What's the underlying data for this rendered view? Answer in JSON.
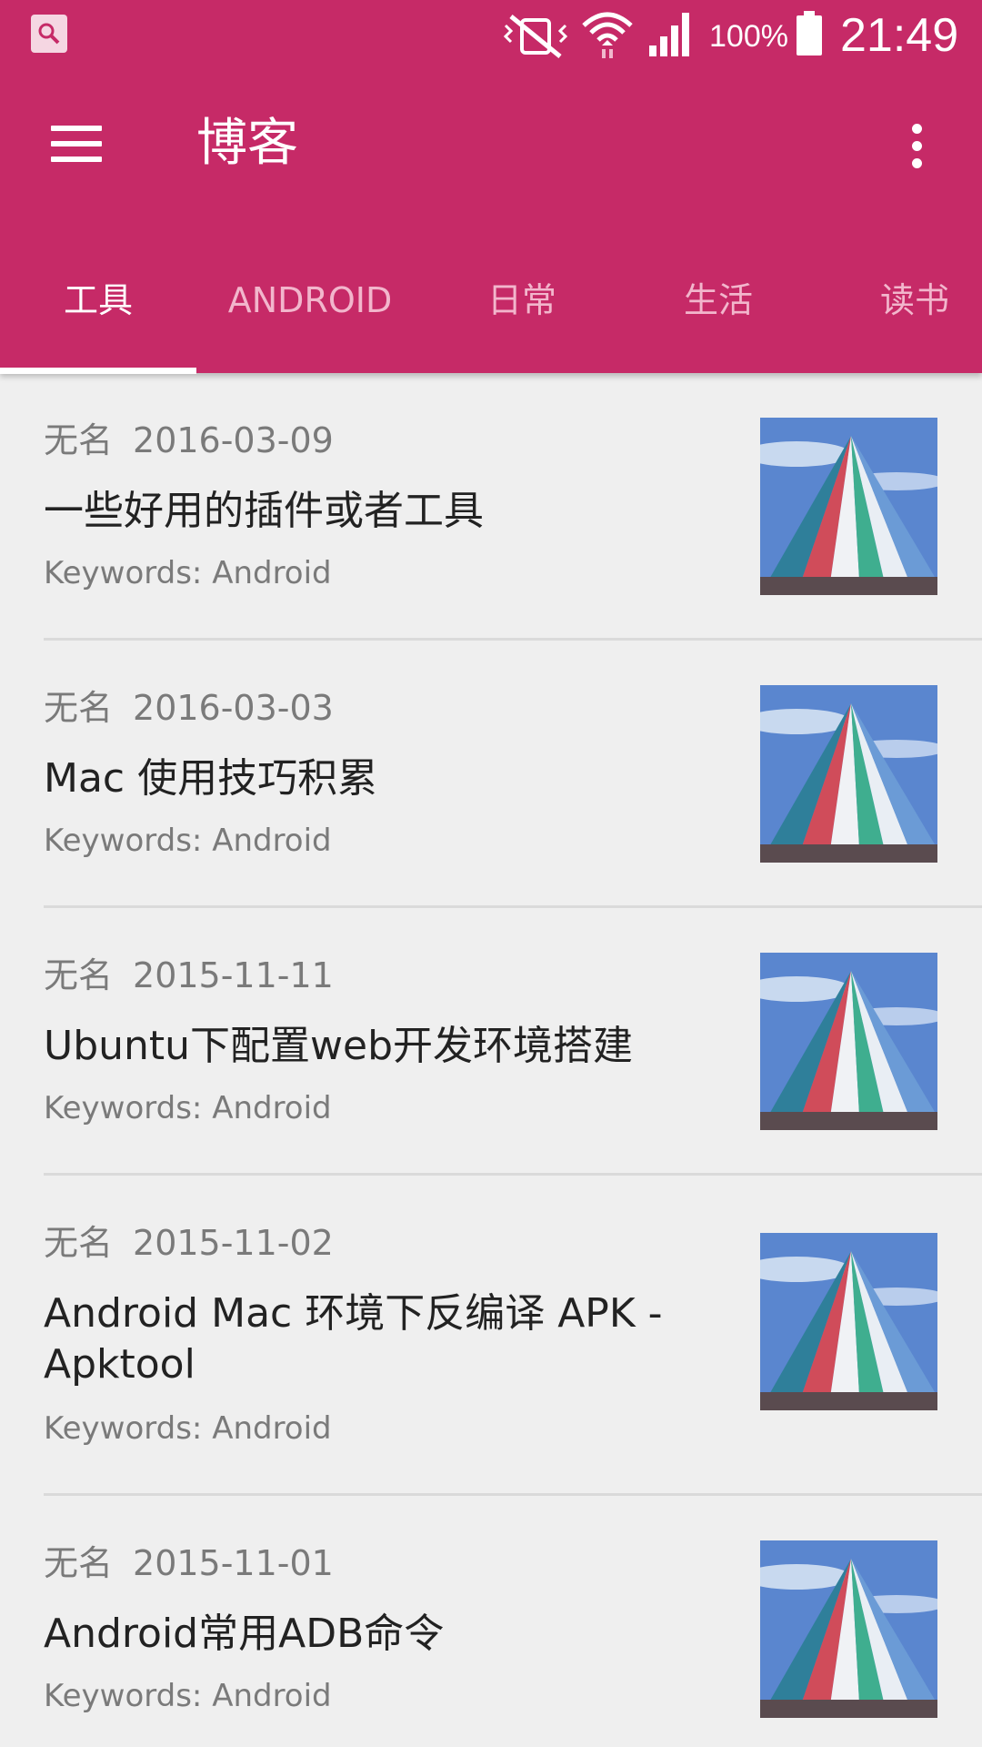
{
  "status_bar": {
    "battery": "100%",
    "time": "21:49",
    "icons": [
      "search-notification-icon",
      "vibrate-mute-icon",
      "wifi-icon",
      "cell-signal-icon",
      "battery-icon"
    ]
  },
  "toolbar": {
    "title": "博客",
    "menu_icon": "hamburger-menu-icon",
    "more_icon": "more-vertical-icon"
  },
  "tabs": [
    {
      "label": "工具",
      "active": true
    },
    {
      "label": "ANDROID",
      "active": false
    },
    {
      "label": "日常",
      "active": false
    },
    {
      "label": "生活",
      "active": false
    },
    {
      "label": "读书",
      "active": false
    }
  ],
  "posts": [
    {
      "author": "无名",
      "date": "2016-03-09",
      "title": "一些好用的插件或者工具",
      "keywords": "Keywords: Android"
    },
    {
      "author": "无名",
      "date": "2016-03-03",
      "title": "Mac 使用技巧积累",
      "keywords": "Keywords: Android"
    },
    {
      "author": "无名",
      "date": "2015-11-11",
      "title": "Ubuntu下配置web开发环境搭建",
      "keywords": "Keywords: Android"
    },
    {
      "author": "无名",
      "date": "2015-11-02",
      "title": "Android Mac 环境下反编译 APK - Apktool",
      "keywords": "Keywords: Android"
    },
    {
      "author": "无名",
      "date": "2015-11-01",
      "title": "Android常用ADB命令",
      "keywords": "Keywords: Android"
    }
  ],
  "colors": {
    "primary": "#c62a67",
    "tab_inactive": "#f2b6cc",
    "background": "#efefef"
  }
}
